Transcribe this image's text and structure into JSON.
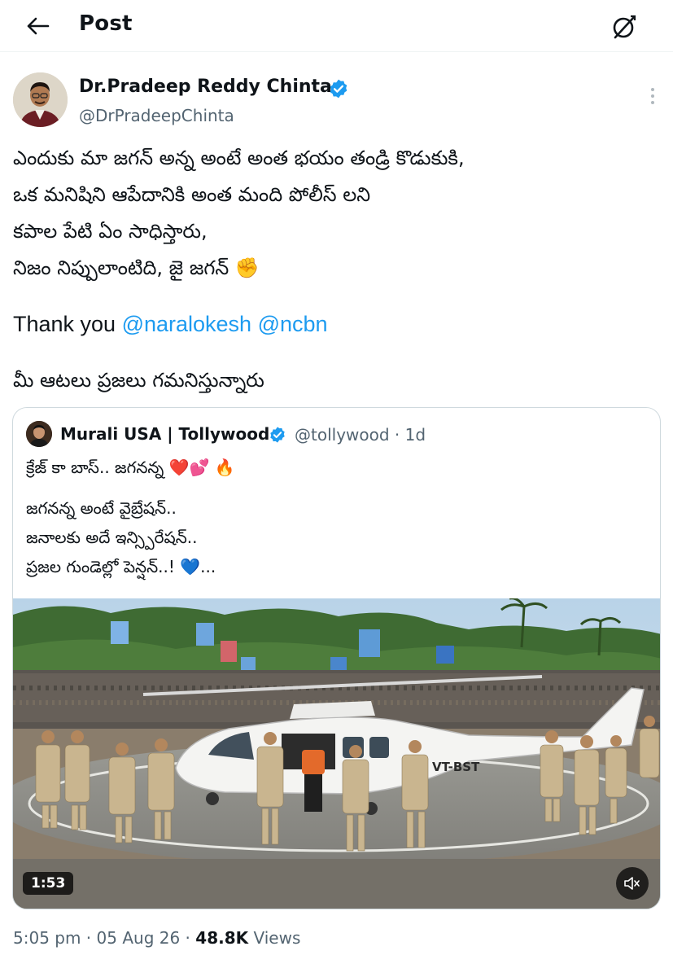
{
  "header": {
    "title": "Post"
  },
  "post": {
    "author_name": "Dr.Pradeep Reddy Chinta",
    "author_handle": "@DrPradeepChinta",
    "text_lines": [
      "ఎందుకు మా జగన్ అన్న అంటే అంత భయం తండ్రి కొడుకుకి,",
      "ఒక మనిషిని ఆపేదానికి అంత మంది పోలీస్ లని",
      "కపాల పేటి ఏం సాధిస్తారు,",
      "నిజం నిప్పులాంటిది, జై జగన్ ✊"
    ],
    "thanks_prefix": "Thank you ",
    "mention_1": "@naralokesh",
    "mention_2": "@ncbn",
    "closing_line": "మీ ఆటలు ప్రజలు గమనిస్తున్నారు",
    "time": "5:05 pm",
    "date": "05 Aug 26",
    "views_count": "48.8K",
    "views_label": "Views"
  },
  "quote": {
    "author_name": "Murali USA | Tollywood",
    "author_handle": "@tollywood",
    "age": "1d",
    "line_1": "క్రేజ్ కా బాస్.. జగనన్న ❤️💕 🔥",
    "line_2": "జగనన్న అంటే వైబ్రేషన్..",
    "line_3": "జనాలకు అదే ఇన్స్పిరేషన్..",
    "line_4": "ప్రజల గుండెల్లో పెన్షన్..! 💙...",
    "video_duration": "1:53",
    "helicopter_reg": "VT-BST"
  },
  "colors": {
    "link": "#1d9bf0",
    "verified": "#1d9bf0",
    "secondary_text": "#536471",
    "border": "#cfd9de"
  },
  "icons": [
    "back-arrow-icon",
    "grok-icon",
    "verified-badge-icon",
    "more-options-icon",
    "mute-icon"
  ]
}
